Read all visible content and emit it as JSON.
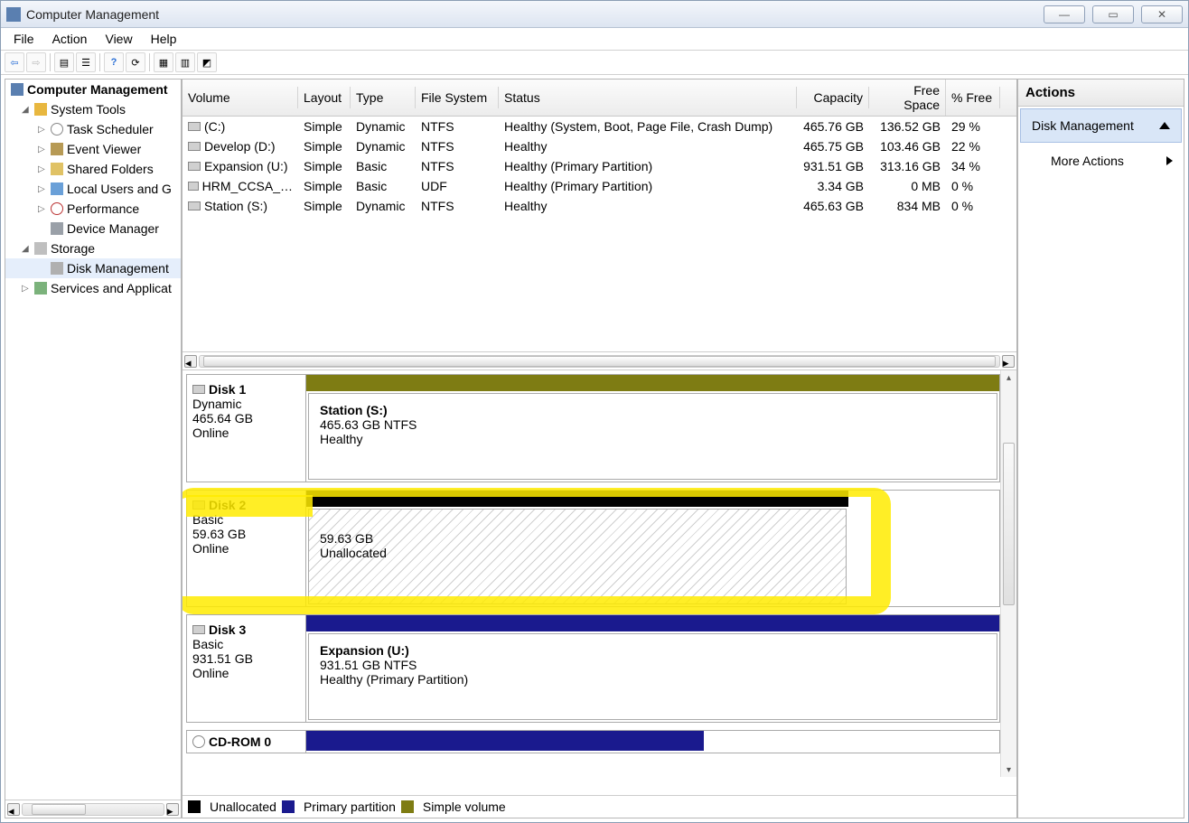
{
  "window": {
    "title": "Computer Management"
  },
  "menu": {
    "file": "File",
    "action": "Action",
    "view": "View",
    "help": "Help"
  },
  "tree": {
    "root": "Computer Management",
    "system_tools": "System Tools",
    "task_scheduler": "Task Scheduler",
    "event_viewer": "Event Viewer",
    "shared_folders": "Shared Folders",
    "local_users": "Local Users and G",
    "performance": "Performance",
    "device_manager": "Device Manager",
    "storage": "Storage",
    "disk_management": "Disk Management",
    "services": "Services and Applicat"
  },
  "columns": {
    "volume": "Volume",
    "layout": "Layout",
    "type": "Type",
    "filesystem": "File System",
    "status": "Status",
    "capacity": "Capacity",
    "freespace": "Free Space",
    "pctfree": "% Free"
  },
  "volumes": [
    {
      "name": "(C:)",
      "layout": "Simple",
      "type": "Dynamic",
      "fs": "NTFS",
      "status": "Healthy (System, Boot, Page File, Crash Dump)",
      "capacity": "465.76 GB",
      "free": "136.52 GB",
      "pct": "29 %"
    },
    {
      "name": "Develop (D:)",
      "layout": "Simple",
      "type": "Dynamic",
      "fs": "NTFS",
      "status": "Healthy",
      "capacity": "465.75 GB",
      "free": "103.46 GB",
      "pct": "22 %"
    },
    {
      "name": "Expansion (U:)",
      "layout": "Simple",
      "type": "Basic",
      "fs": "NTFS",
      "status": "Healthy (Primary Partition)",
      "capacity": "931.51 GB",
      "free": "313.16 GB",
      "pct": "34 %"
    },
    {
      "name": "HRM_CCSA_…",
      "layout": "Simple",
      "type": "Basic",
      "fs": "UDF",
      "status": "Healthy (Primary Partition)",
      "capacity": "3.34 GB",
      "free": "0 MB",
      "pct": "0 %"
    },
    {
      "name": "Station (S:)",
      "layout": "Simple",
      "type": "Dynamic",
      "fs": "NTFS",
      "status": "Healthy",
      "capacity": "465.63 GB",
      "free": "834 MB",
      "pct": "0 %"
    }
  ],
  "disks": {
    "d1": {
      "title": "Disk 1",
      "type": "Dynamic",
      "size": "465.64 GB",
      "state": "Online",
      "part_title": "Station  (S:)",
      "part_line": "465.63 GB NTFS",
      "part_status": "Healthy"
    },
    "d2": {
      "title": "Disk 2",
      "type": "Basic",
      "size": "59.63 GB",
      "state": "Online",
      "part_line": "59.63 GB",
      "part_status": "Unallocated"
    },
    "d3": {
      "title": "Disk 3",
      "type": "Basic",
      "size": "931.51 GB",
      "state": "Online",
      "part_title": "Expansion  (U:)",
      "part_line": "931.51 GB NTFS",
      "part_status": "Healthy (Primary Partition)"
    },
    "cd": {
      "title": "CD-ROM 0"
    }
  },
  "legend": {
    "unallocated": "Unallocated",
    "primary": "Primary partition",
    "simple": "Simple volume"
  },
  "actions": {
    "header": "Actions",
    "disk_mgmt": "Disk Management",
    "more": "More Actions"
  }
}
